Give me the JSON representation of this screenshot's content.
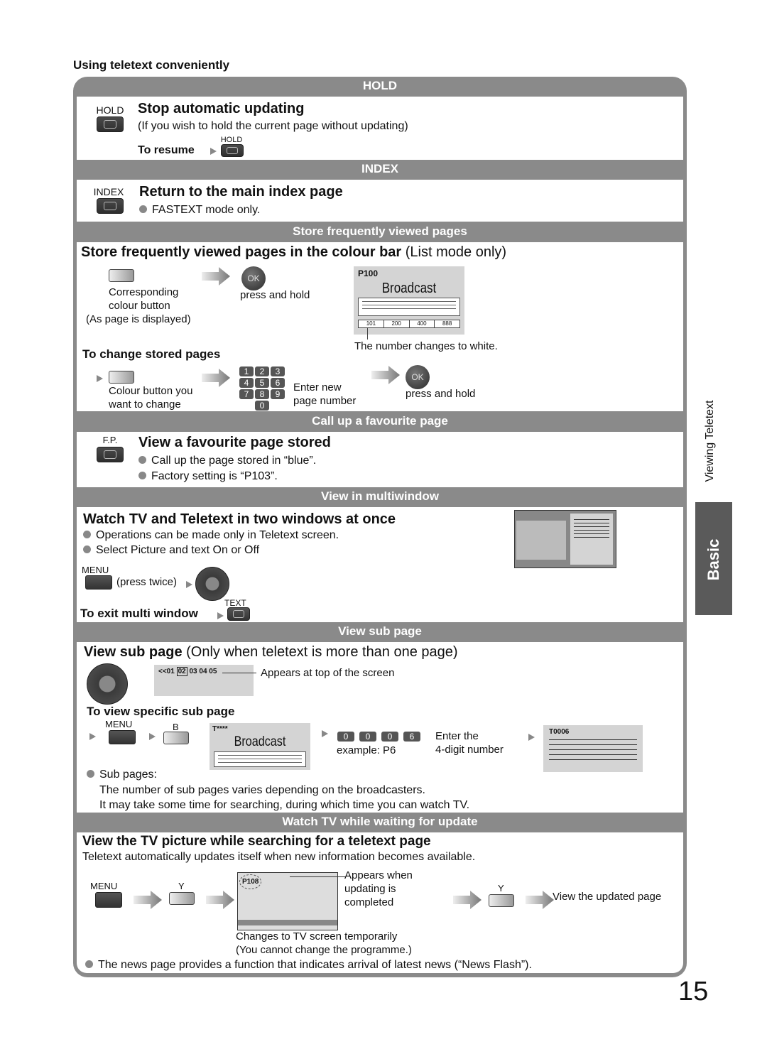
{
  "page": {
    "section_title": "Using teletext conveniently",
    "page_number": "15",
    "side_label": "Viewing Teletext",
    "side_tab": "Basic"
  },
  "hold": {
    "bar": "HOLD",
    "button_label": "HOLD",
    "title": "Stop automatic updating",
    "desc": "(If you wish to hold the current page without updating)",
    "resume_label": "To resume",
    "resume_button_label": "HOLD"
  },
  "index": {
    "bar": "INDEX",
    "button_label": "INDEX",
    "title": "Return to the main index page",
    "bullet": "FASTEXT mode only."
  },
  "store": {
    "bar": "Store frequently viewed pages",
    "title_bold": "Store frequently viewed pages in the colour bar",
    "title_normal": " (List mode only)",
    "step1_caption": [
      "Corresponding",
      "colour button",
      "(As page is displayed)"
    ],
    "ok_label": "OK",
    "step2_caption": "press and hold",
    "screen": {
      "page": "P100",
      "title": "Broadcast",
      "numbers": [
        "101",
        "200",
        "400",
        "888"
      ],
      "caption": "The number changes to white."
    },
    "change_title": "To change stored pages",
    "change_step1_caption": [
      "Colour button you",
      "want to change"
    ],
    "keypad": [
      "1",
      "2",
      "3",
      "4",
      "5",
      "6",
      "7",
      "8",
      "9",
      "0"
    ],
    "change_step2_caption": [
      "Enter new",
      "page number"
    ],
    "change_step3_caption": "press and hold"
  },
  "favourite": {
    "bar": "Call up a favourite page",
    "button_label": "F.P.",
    "title": "View a favourite page stored",
    "bullets": [
      "Call up the page stored in “blue”.",
      "Factory setting is “P103”."
    ]
  },
  "multiwindow": {
    "bar": "View in multiwindow",
    "title": "Watch TV and Teletext in two windows at once",
    "bullets": [
      "Operations can be made only in Teletext screen.",
      "Select Picture and text On or Off"
    ],
    "menu_label": "MENU",
    "press_twice": "(press twice)",
    "exit_label": "To exit multi window",
    "text_button_label": "TEXT"
  },
  "subpage": {
    "bar": "View sub page",
    "title_bold": "View sub page",
    "title_normal": " (Only when teletext is more than one page)",
    "strip": {
      "prefix": "<<01",
      "selected": "02",
      "rest": "03 04 05"
    },
    "strip_caption": "Appears at top of the screen",
    "specific_title": "To view specific sub page",
    "menu_label": "MENU",
    "b_label": "B",
    "screen": {
      "page": "T****",
      "title": "Broadcast"
    },
    "digits": [
      "0",
      "0",
      "0",
      "6"
    ],
    "example": "example: P6",
    "enter_caption": [
      "Enter the",
      "4-digit number"
    ],
    "result_screen": {
      "page": "T0006"
    },
    "bullet_title": "Sub pages:",
    "notes": [
      "The number of sub pages varies depending on the broadcasters.",
      "It may take some time for searching, during which time you can watch TV."
    ]
  },
  "update": {
    "bar": "Watch TV while waiting for update",
    "title": "View the TV picture while searching for a teletext page",
    "desc": "Teletext automatically updates itself when new information becomes available.",
    "menu_label": "MENU",
    "y_label": "Y",
    "tv_badge": "P108",
    "appears_caption": [
      "Appears when",
      "updating is",
      "completed"
    ],
    "tv_caption": [
      "Changes to TV screen temporarily",
      "(You cannot change the programme.)"
    ],
    "y2_label": "Y",
    "final_caption": "View the updated page",
    "bullet": "The news page provides a function that indicates arrival of latest news (“News Flash”)."
  }
}
